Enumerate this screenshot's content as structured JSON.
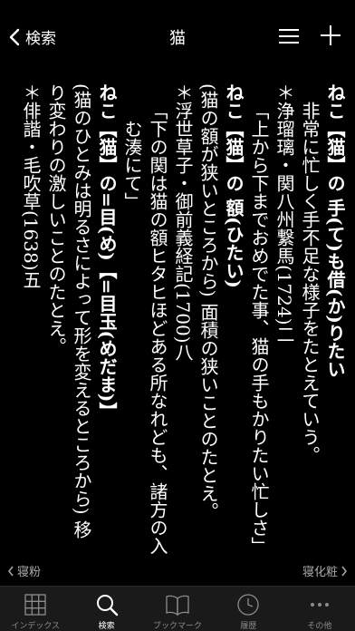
{
  "nav": {
    "back_label": "検索",
    "title": "猫"
  },
  "entry": {
    "col1": "ねこ【猫】の 手(て)も借(か)りたい",
    "col2": "非常に忙しく手不足な様子をたとえていう。",
    "col3": "＊浄瑠璃・関八州繋馬(1724)二",
    "col4": "「上から下までおめでた事、猫の手もかりたい忙しさ」",
    "col5": "ねこ【猫】の 額(ひたい)",
    "col6": "(猫の額が狭いところから) 面積の狭いことのたとえ。",
    "col7": "＊浮世草子・御前義経記(1700)八",
    "col8": "「下の関は猫の額ヒタヒほどある所なれども、諸方の入込",
    "col9": "む湊にて」",
    "col10": "ねこ【猫】の=目(め)【=目玉(めだま)】",
    "col11": "(猫のひとみは明るさによって形を変えるところから) 移",
    "col12": "り変わりの激しいことのたとえ。",
    "col13": "＊俳諧・毛吹草(1638)五"
  },
  "pager": {
    "prev": "寝粉",
    "next": "寝化粧"
  },
  "tabs": [
    {
      "label": "インデックス",
      "icon": "grid-icon"
    },
    {
      "label": "検索",
      "icon": "search-icon"
    },
    {
      "label": "ブックマーク",
      "icon": "book-icon"
    },
    {
      "label": "履歴",
      "icon": "clock-icon"
    },
    {
      "label": "その他",
      "icon": "more-icon"
    }
  ]
}
